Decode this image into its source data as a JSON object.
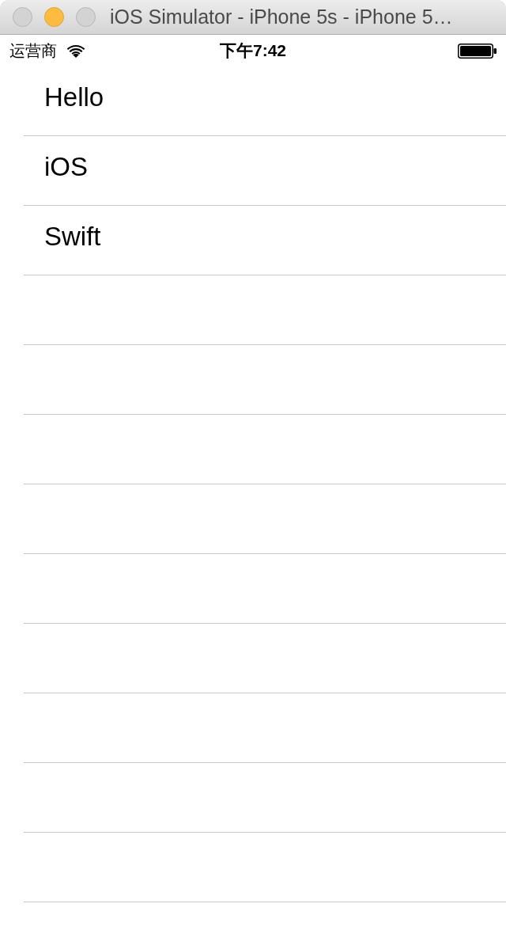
{
  "window": {
    "title": "iOS Simulator - iPhone 5s - iPhone 5…",
    "controls": [
      {
        "kind": "close",
        "disabled": true
      },
      {
        "kind": "minimize",
        "disabled": false
      },
      {
        "kind": "zoom",
        "disabled": true
      }
    ]
  },
  "status_bar": {
    "carrier": "运营商",
    "time": "下午7:42"
  },
  "table": {
    "rows": [
      {
        "title": "Hello"
      },
      {
        "title": "iOS"
      },
      {
        "title": "Swift"
      }
    ]
  }
}
